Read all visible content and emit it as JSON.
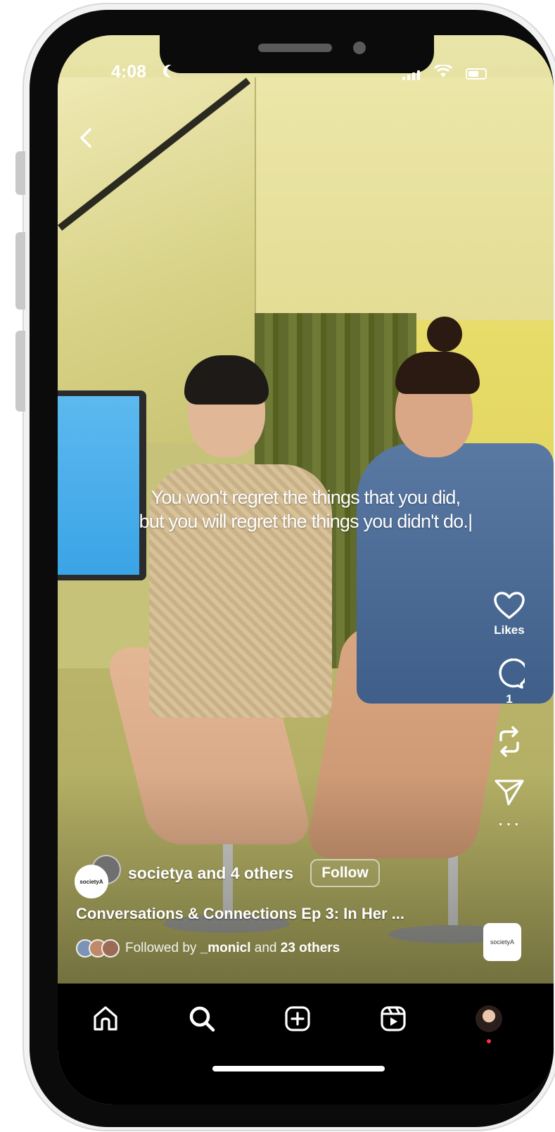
{
  "status_bar": {
    "time": "4:08"
  },
  "caption": {
    "line1": "You won't regret the things that you did,",
    "line2": "but you will regret the things you didn't do.|"
  },
  "actions": {
    "likes_label": "Likes",
    "comments_count": "1"
  },
  "author": {
    "avatar_text": "societyA",
    "name": "societya and 4 others",
    "follow_label": "Follow"
  },
  "reel": {
    "title": "Conversations & Connections Ep 3: In Her ...",
    "followed_prefix": "Followed by",
    "followed_user": "_monicl",
    "followed_mid": "and",
    "followed_count": "23 others"
  },
  "audio": {
    "thumb_text": "societyA"
  },
  "colors": {
    "nav_bg": "#000000",
    "notification": "#ff3040",
    "text": "#ffffff"
  },
  "icons": {
    "nav": [
      "home-icon",
      "search-icon",
      "create-icon",
      "reels-icon",
      "profile-avatar"
    ],
    "actions": [
      "heart-icon",
      "comment-icon",
      "repost-icon",
      "share-icon",
      "more-icon"
    ]
  }
}
